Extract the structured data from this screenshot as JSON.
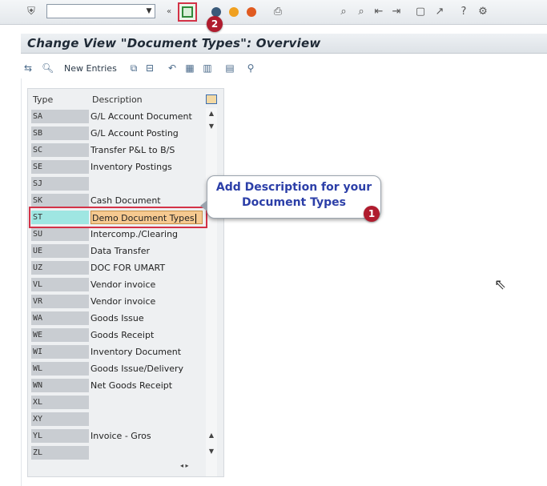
{
  "toolbar": {
    "save_icon": "save-icon",
    "step2_badge": "2"
  },
  "view": {
    "title": "Change View \"Document Types\": Overview"
  },
  "app_toolbar": {
    "new_entries_label": "New Entries"
  },
  "table": {
    "headers": {
      "type": "Type",
      "description": "Description"
    },
    "rows": [
      {
        "type": "SA",
        "description": "G/L Account Document"
      },
      {
        "type": "SB",
        "description": "G/L Account Posting"
      },
      {
        "type": "SC",
        "description": "Transfer P&L to B/S"
      },
      {
        "type": "SE",
        "description": "Inventory Postings"
      },
      {
        "type": "SJ",
        "description": ""
      },
      {
        "type": "SK",
        "description": "Cash Document"
      },
      {
        "type": "ST",
        "description": "Demo Document Types"
      },
      {
        "type": "SU",
        "description": "Intercomp./Clearing"
      },
      {
        "type": "UE",
        "description": "Data Transfer"
      },
      {
        "type": "UZ",
        "description": "DOC FOR UMART"
      },
      {
        "type": "VL",
        "description": "Vendor invoice"
      },
      {
        "type": "VR",
        "description": "Vendor invoice"
      },
      {
        "type": "WA",
        "description": "Goods Issue"
      },
      {
        "type": "WE",
        "description": "Goods Receipt"
      },
      {
        "type": "WI",
        "description": "Inventory Document"
      },
      {
        "type": "WL",
        "description": "Goods Issue/Delivery"
      },
      {
        "type": "WN",
        "description": "Net Goods Receipt"
      },
      {
        "type": "XL",
        "description": ""
      },
      {
        "type": "XY",
        "description": ""
      },
      {
        "type": "YL",
        "description": "Invoice - Gros"
      },
      {
        "type": "ZL",
        "description": ""
      }
    ]
  },
  "callout": {
    "line1": "Add Description for your",
    "line2": "Document Types",
    "badge": "1"
  },
  "colors": {
    "highlight": "#d33247",
    "callout_text": "#2c3fa8",
    "selected_desc_bg": "#f6c990"
  }
}
